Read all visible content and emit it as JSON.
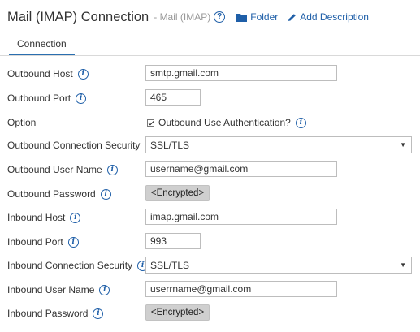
{
  "header": {
    "title": "Mail (IMAP) Connection",
    "subtitle": "- Mail (IMAP)",
    "help_icon": "question-circle-icon",
    "folder_label": "Folder",
    "description_label": "Add Description"
  },
  "tabs": [
    {
      "label": "Connection"
    }
  ],
  "fields": {
    "outbound_host": {
      "label": "Outbound Host",
      "value": "smtp.gmail.com"
    },
    "outbound_port": {
      "label": "Outbound Port",
      "value": "465"
    },
    "option": {
      "label": "Option",
      "checkbox_label": "Outbound Use Authentication?",
      "checked": true
    },
    "outbound_security": {
      "label": "Outbound Connection Security",
      "value": "SSL/TLS"
    },
    "outbound_user": {
      "label": "Outbound User Name",
      "value": "username@gmail.com"
    },
    "outbound_password": {
      "label": "Outbound Password",
      "value": "<Encrypted>"
    },
    "inbound_host": {
      "label": "Inbound Host",
      "value": "imap.gmail.com"
    },
    "inbound_port": {
      "label": "Inbound Port",
      "value": "993"
    },
    "inbound_security": {
      "label": "Inbound Connection Security",
      "value": "SSL/TLS"
    },
    "inbound_user": {
      "label": "Inbound User Name",
      "value": "userrname@gmail.com"
    },
    "inbound_password": {
      "label": "Inbound Password",
      "value": "<Encrypted>"
    }
  },
  "colors": {
    "link": "#1f5fa8",
    "tab_underline": "#2a6fb0",
    "encrypted_bg": "#cfcfcf"
  }
}
